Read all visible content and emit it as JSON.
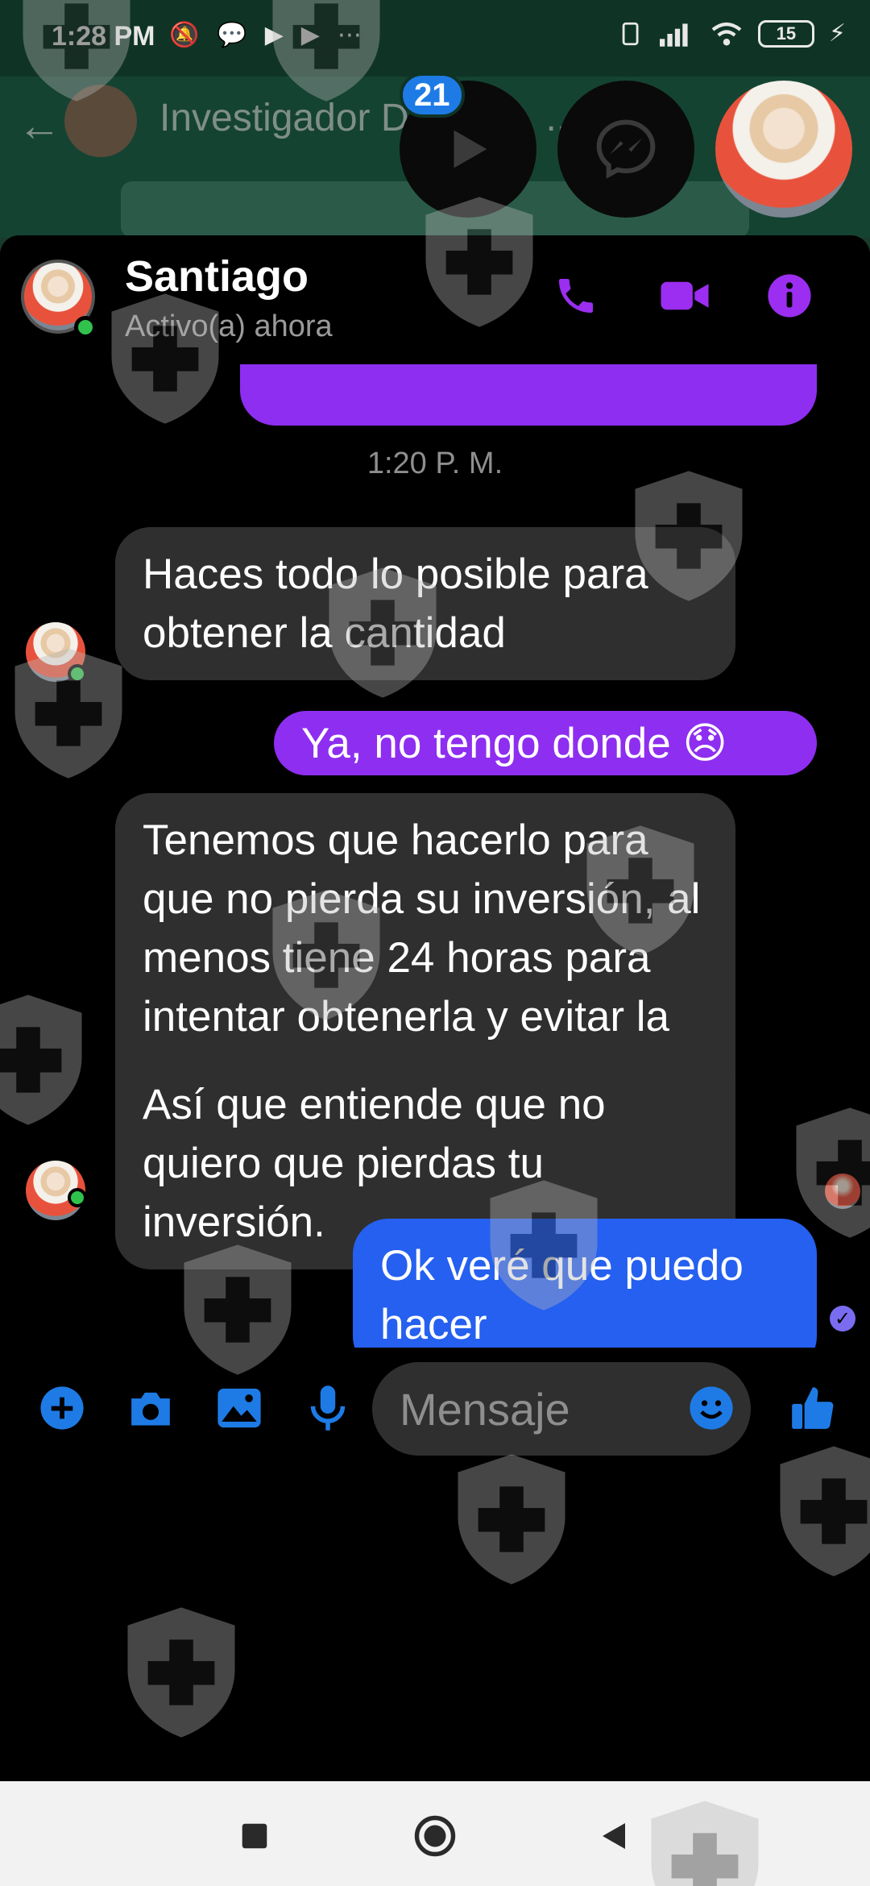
{
  "status_bar": {
    "time": "1:28 PM",
    "battery": "15"
  },
  "background_app": {
    "title": "Investigador D",
    "title_suffix": "..."
  },
  "chat_heads": {
    "unread_badge": "21"
  },
  "header": {
    "name": "Santiago",
    "status": "Activo(a) ahora"
  },
  "thread": {
    "timestamp": "1:20 P. M.",
    "messages": [
      {
        "direction": "in",
        "text": "Haces todo lo posible para obtener la cantidad"
      },
      {
        "direction": "out",
        "text": "Ya, no tengo donde 😞"
      },
      {
        "direction": "in",
        "text": "Tenemos que hacerlo para que no pierda su inversión, al menos tiene 24 horas para intentar obtenerla y evitar la pérdida de fondos."
      },
      {
        "direction": "in",
        "text": "Así que entiende que no quiero que pierdas tu inversión."
      },
      {
        "direction": "out",
        "text": "Ok veré que puedo hacer"
      }
    ]
  },
  "composer": {
    "placeholder": "Mensaje"
  },
  "colors": {
    "outgoing_purple": "#8e2ef0",
    "outgoing_blue": "#2560f0",
    "incoming": "#2f2f2f",
    "accent": "#1e7be6",
    "header_icons": "#9b2ef0",
    "online": "#31c24d"
  },
  "icons": {
    "header": [
      "phone-icon",
      "video-camera-icon",
      "info-icon"
    ],
    "composer": [
      "plus-circle-icon",
      "camera-icon",
      "gallery-icon",
      "microphone-icon",
      "emoji-icon",
      "thumbs-up-icon"
    ],
    "navbar": [
      "recents-square-icon",
      "home-circle-icon",
      "back-triangle-icon"
    ]
  }
}
